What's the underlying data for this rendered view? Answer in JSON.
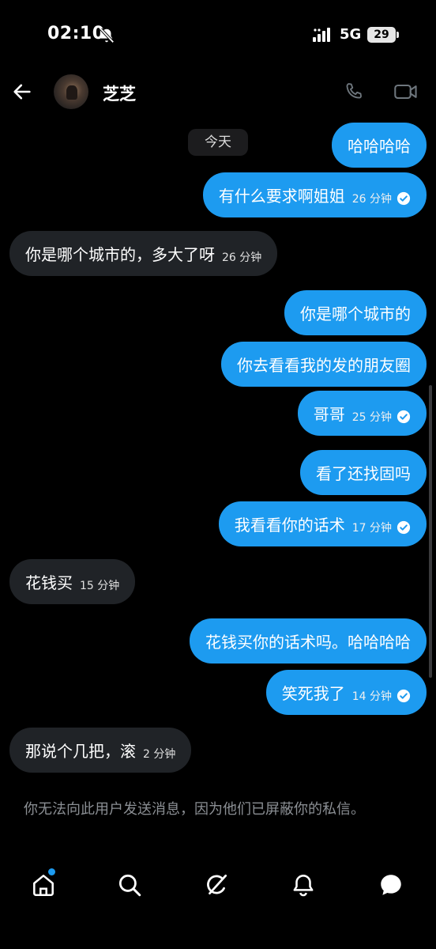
{
  "status_bar": {
    "time": "02:10",
    "network": "5G",
    "battery": "29"
  },
  "header": {
    "contact_name": "芝芝"
  },
  "date_chip": "今天",
  "messages": [
    {
      "dir": "out",
      "text": "哈哈哈哈",
      "time": "",
      "read": false
    },
    {
      "dir": "out",
      "text": "有什么要求啊姐姐",
      "time": "26 分钟",
      "read": true
    },
    {
      "dir": "in",
      "text": "你是哪个城市的，多大了呀",
      "time": "26 分钟",
      "read": false
    },
    {
      "dir": "out",
      "text": "你是哪个城市的",
      "time": "",
      "read": false
    },
    {
      "dir": "out",
      "text": "你去看看我的发的朋友圈",
      "time": "",
      "read": false
    },
    {
      "dir": "out",
      "text": "哥哥",
      "time": "25 分钟",
      "read": true
    },
    {
      "dir": "out",
      "text": "看了还找固吗",
      "time": "",
      "read": false
    },
    {
      "dir": "out",
      "text": "我看看你的话术",
      "time": "17 分钟",
      "read": true
    },
    {
      "dir": "in",
      "text": "花钱买",
      "time": "15 分钟",
      "read": false
    },
    {
      "dir": "out",
      "text": "花钱买你的话术吗。哈哈哈哈",
      "time": "",
      "read": false
    },
    {
      "dir": "out",
      "text": "笑死我了",
      "time": "14 分钟",
      "read": true
    },
    {
      "dir": "in",
      "text": "那说个几把，滚",
      "time": "2 分钟",
      "read": false
    }
  ],
  "notice": "你无法向此用户发送消息，因为他们已屏蔽你的私信。",
  "icons": {
    "back": "back-arrow-icon",
    "phone": "phone-icon",
    "video": "video-camera-icon",
    "home": "home-icon",
    "search": "search-icon",
    "grok": "grok-icon",
    "notifications": "bell-icon",
    "messages": "messages-icon",
    "read": "check-circle-icon"
  },
  "colors": {
    "outgoing_bubble": "#1d9bf0",
    "incoming_bubble": "#202327",
    "background": "#000000",
    "notice_text": "#8b8f94"
  }
}
